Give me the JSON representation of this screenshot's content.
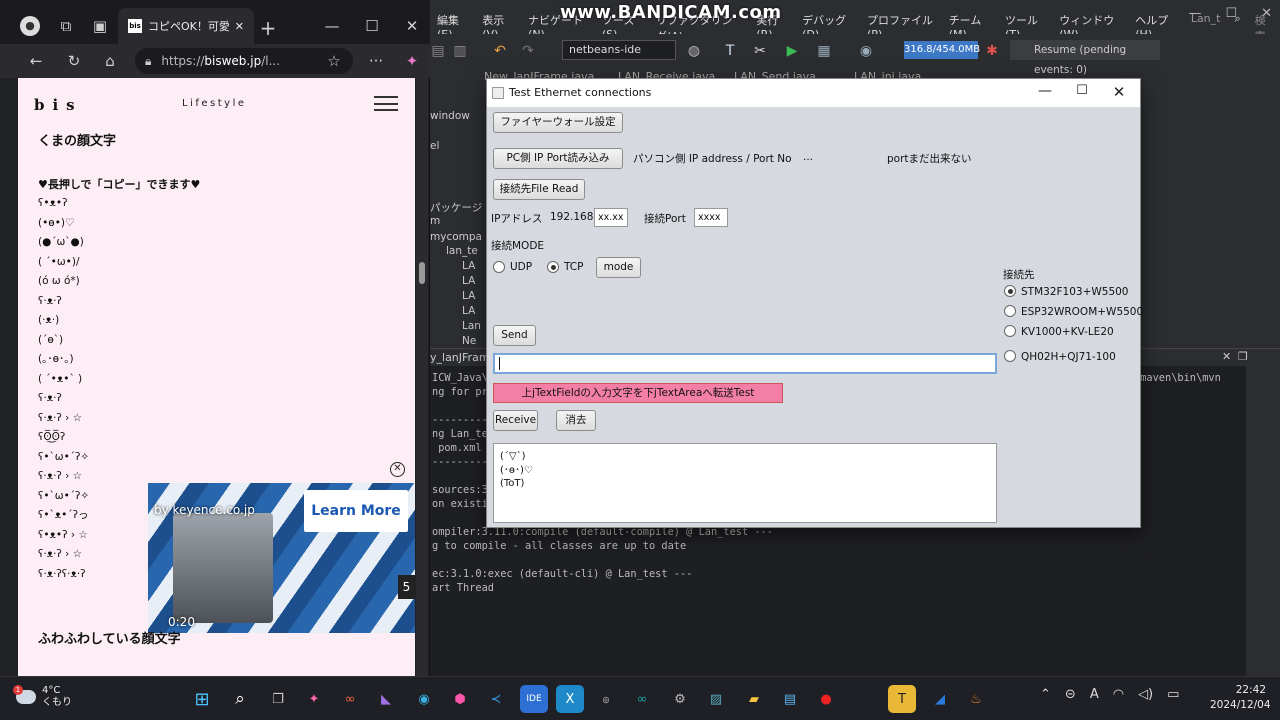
{
  "browser": {
    "tab_title": "コピペOK！可愛い",
    "url_prefix": "https://",
    "url_host": "bisweb.jp",
    "url_rest": "/l...",
    "site": {
      "logo": "bis",
      "category": "Lifestyle",
      "section1_title": "くまの顔文字",
      "copy_hint": "♥長押しで「コピー」できます♥",
      "kaomoji": [
        "ʕ•ᴥ•ʔ",
        "(•ө•)♡",
        "(●´ω`●)",
        "( ´•ω•)/",
        "(ó ω ó*)",
        "ʕ·ᴥ·ʔ",
        "(·ᴥ·)",
        "(´ө`)",
        "(｡･ө･｡)",
        "( ´•ᴥ•` )",
        "ʕ·ᴥ·ʔ",
        "ʕ·ᴥ·ʔ › ☆",
        "ʕʘ̅͜ʘ̅ʔ",
        "ʕ•`ω•´ʔ✧",
        "ʕ·ᴥ·ʔ › ☆",
        "ʕ•`ω•´ʔ✧",
        "ʕ•`ᴥ•´ʔっ",
        "ʕ•ᴥ•ʔ › ☆",
        "ʕ·ᴥ·ʔ › ☆",
        "ʕ·ᴥ·ʔʕ·ᴥ·ʔ"
      ],
      "section2_title": "ふわふわしている顔文字"
    },
    "ad": {
      "sponsor": "by keyence.co.jp",
      "cta": "Learn More",
      "time": "0:20",
      "countdown": "5"
    }
  },
  "ide": {
    "menu": [
      "編集(E)",
      "表示(V)",
      "ナビゲート(N)",
      "ソース(S)",
      "リファクタリング(A)",
      "実行(R)",
      "デバッグ(D)",
      "プロファイル(P)",
      "チーム(M)",
      "ツール(T)",
      "ウィンドウ(W)",
      "ヘルプ(H)"
    ],
    "project_label": "Lan_t",
    "search_label": "検索",
    "config_combo": "netbeans-ide",
    "memory": "316.8/454.0MB",
    "resume": "Resume (pending events: 0)",
    "editor_tabs": [
      "New_lanJFrame.java",
      "LAN_Receive.java",
      "LAN_Send.java",
      "LAN_ini.java"
    ],
    "left_panel": [
      "window",
      "el",
      "パッケージ",
      "m",
      "mycompa",
      "lan_te",
      "LA",
      "LA",
      "LA",
      "LA",
      "Lan",
      "Ne"
    ],
    "output_tab": "y_lanJFrame)",
    "output_lines": [
      "ICW_Java\\",
      "ng for pr",
      "",
      "----------",
      "ng Lan_te",
      " pom.xml",
      "----------",
      "",
      "sources:3",
      "on existi",
      "",
      "",
      "ompiler:3.11.0:compile (default-compile) @ Lan_test ---",
      "g to compile - all classes are up to date",
      "",
      "ec:3.1.0:exec (default-cli) @ Lan_test ---",
      "art Thread"
    ],
    "output_path_tail": "\\maven\\bin\\mvn"
  },
  "dialog": {
    "title": "Test Ethernet connections",
    "firewall_button": "ファイヤーウォール設定",
    "pc_ip_button": "PC側 IP Port読み込み",
    "pc_ip_label": "パソコン側 IP address / Port No",
    "pc_ip_value": "...",
    "port_note": "portまだ出来ない",
    "file_read_button": "接続先File Read",
    "ip_label": "IPアドレス",
    "ip_prefix": "192.168.",
    "ip_field": "xx.xx",
    "port_label": "接続Port",
    "port_field": "xxxx",
    "mode_label": "接続MODE",
    "udp_label": "UDP",
    "tcp_label": "TCP",
    "mode_button": "mode",
    "target_label": "接続先",
    "targets": [
      "STM32F103+W5500",
      "ESP32WROOM+W5500",
      "KV1000+KV-LE20",
      "QH02H+QJ71-100"
    ],
    "send_button": "Send",
    "transfer_button": "上jTextFieldの入力文字を下jTextAreaへ転送Test",
    "receive_button": "Receive",
    "clear_button": "消去",
    "area_lines": [
      "(´▽`)",
      "(･ө･)♡",
      "(ToT)"
    ]
  },
  "watermark": "www.BANDICAM.com",
  "taskbar": {
    "temp": "4°C",
    "weather": "くもり",
    "weather_badge": "1",
    "apps": [
      "start",
      "search",
      "task-view",
      "copilot",
      "chrome-game",
      "visual-studio",
      "edge",
      "app-hex",
      "vscode",
      "intellij",
      "excel",
      "rpa",
      "arduino",
      "settings",
      "cad",
      "explorer",
      "notepad",
      "recorder",
      "typora",
      "sky",
      "java"
    ],
    "time": "22:42",
    "date": "2024/12/04",
    "ime": "A"
  }
}
